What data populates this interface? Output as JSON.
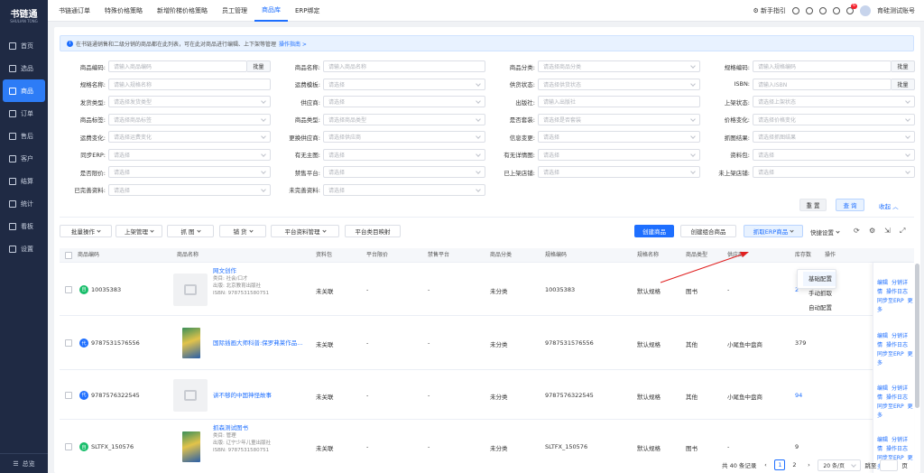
{
  "app": {
    "logo": "书链通",
    "logo_sub": "SHULIAN TONG",
    "footer_label": "总览"
  },
  "sidebar": [
    {
      "label": "首页",
      "active": false
    },
    {
      "label": "选品",
      "active": false
    },
    {
      "label": "商品",
      "active": true
    },
    {
      "label": "订单",
      "active": false
    },
    {
      "label": "售后",
      "active": false
    },
    {
      "label": "客户",
      "active": false
    },
    {
      "label": "结算",
      "active": false
    },
    {
      "label": "统计",
      "active": false
    },
    {
      "label": "看板",
      "active": false
    },
    {
      "label": "设置",
      "active": false
    }
  ],
  "tabs": [
    {
      "label": "书链通订单"
    },
    {
      "label": "特殊价格策略"
    },
    {
      "label": "新增阶梯价格策略"
    },
    {
      "label": "员工管理"
    },
    {
      "label": "商品库",
      "active": true
    },
    {
      "label": "ERP绑定"
    }
  ],
  "topright": {
    "guide": "新手指引",
    "badge": "6",
    "user": "育硅测试账号"
  },
  "notice": {
    "text": "在书链通销售和二级分销的商品都在此列表，可在此对商品进行编辑、上下架等管理",
    "link": "操作指南 >"
  },
  "filters": {
    "batch": "批量",
    "rows": [
      [
        {
          "label": "商品编码:",
          "ph": "请输入商品编码",
          "batch": true
        },
        {
          "label": "商品名称:",
          "ph": "请输入商品名称"
        },
        {
          "label": "商品分类:",
          "ph": "请选择商品分类",
          "sel": true
        },
        {
          "label": "规格编码:",
          "ph": "请输入规格编码",
          "batch": true
        }
      ],
      [
        {
          "label": "规格名称:",
          "ph": "请输入规格名称"
        },
        {
          "label": "运费模板:",
          "ph": "请选择",
          "sel": true
        },
        {
          "label": "供货状态:",
          "ph": "请选择供货状态",
          "sel": true
        },
        {
          "label": "ISBN:",
          "ph": "请输入ISBN",
          "batch": true
        }
      ],
      [
        {
          "label": "发货类型:",
          "ph": "请选择发货类型",
          "sel": true
        },
        {
          "label": "供应商:",
          "ph": "请选择",
          "sel": true
        },
        {
          "label": "出版社:",
          "ph": "请输入出版社"
        },
        {
          "label": "上架状态:",
          "ph": "请选择上架状态",
          "sel": true
        }
      ],
      [
        {
          "label": "商品标签:",
          "ph": "请选择商品标签",
          "sel": true
        },
        {
          "label": "商品类型:",
          "ph": "请选择商品类型",
          "sel": true
        },
        {
          "label": "是否套装:",
          "ph": "请选择是否套装",
          "sel": true
        },
        {
          "label": "价格变化:",
          "ph": "请选择价格变化",
          "sel": true
        }
      ],
      [
        {
          "label": "运费变化:",
          "ph": "请选择运费变化",
          "sel": true
        },
        {
          "label": "更换供应商:",
          "ph": "请选择供应商",
          "sel": true
        },
        {
          "label": "信息变更:",
          "ph": "请选择",
          "sel": true
        },
        {
          "label": "抓图结果:",
          "ph": "请选择抓图结果",
          "sel": true
        }
      ],
      [
        {
          "label": "同步ERP:",
          "ph": "请选择",
          "sel": true
        },
        {
          "label": "有无主图:",
          "ph": "请选择",
          "sel": true
        },
        {
          "label": "有无详情图:",
          "ph": "请选择",
          "sel": true
        },
        {
          "label": "资料包:",
          "ph": "请选择",
          "sel": true
        }
      ],
      [
        {
          "label": "是否限价:",
          "ph": "请选择",
          "sel": true
        },
        {
          "label": "禁售平台:",
          "ph": "请选择",
          "sel": true
        },
        {
          "label": "已上架店铺:",
          "ph": "请选择",
          "sel": true
        },
        {
          "label": "未上架店铺:",
          "ph": "请选择",
          "sel": true
        }
      ],
      [
        {
          "label": "已完善资料:",
          "ph": "请选择",
          "sel": true
        },
        {
          "label": "未完善资料:",
          "ph": "请选择",
          "sel": true
        }
      ]
    ],
    "reset": "重 置",
    "search": "查 询",
    "collapse": "收起"
  },
  "toolbar": {
    "left": [
      "批量操作",
      "上架管理",
      "抓 图",
      "铺 货",
      "平台资料管理"
    ],
    "map": "平台类目映射",
    "create": "创建商品",
    "create_combo": "创建组合商品",
    "fetch_erp": "抓取ERP商品",
    "quick": "快捷设置"
  },
  "dropdown": [
    "基础配置",
    "手动抓取",
    "自动配置"
  ],
  "table": {
    "headers": [
      "商品编码",
      "商品名称",
      "资料包",
      "平台限价",
      "禁售平台",
      "商品分类",
      "规格编码",
      "规格名称",
      "商品类型",
      "供应商",
      "库存数",
      "操作"
    ],
    "rows": [
      {
        "code": "10035383",
        "tag": "自",
        "tagcolor": "#19be6b",
        "name": "网文创作",
        "meta1": "类目: 社会/口才",
        "meta2": "出版: 北京教育出版社",
        "meta3": "ISBN: 9787531580751",
        "pkg": "未关联",
        "limit": "-",
        "ban": "-",
        "cat": "未分类",
        "sku": "10035383",
        "spec": "默认规格",
        "type": "图书",
        "sup": "-",
        "stock": "2",
        "img": "ph"
      },
      {
        "code": "9787531576556",
        "tag": "代",
        "tagcolor": "#1e6fff",
        "name": "国际插画大师科普:保罗弗莱作品...",
        "meta1": "",
        "meta2": "",
        "meta3": "",
        "pkg": "未关联",
        "limit": "-",
        "ban": "-",
        "cat": "未分类",
        "sku": "9787531576556",
        "spec": "默认规格",
        "type": "其他",
        "sup": "小尾鱼中盘商",
        "stock": "379",
        "img": "book"
      },
      {
        "code": "9787576322545",
        "tag": "代",
        "tagcolor": "#1e6fff",
        "name": "讲不够的中国神怪故事",
        "meta1": "",
        "meta2": "",
        "meta3": "",
        "pkg": "未关联",
        "limit": "-",
        "ban": "-",
        "cat": "未分类",
        "sku": "9787576322545",
        "spec": "默认规格",
        "type": "其他",
        "sup": "小尾鱼中盘商",
        "stock": "94",
        "img": "ph"
      },
      {
        "code": "SLTFX_150576",
        "tag": "自",
        "tagcolor": "#19be6b",
        "name": "抓森测试图书",
        "meta1": "类目: 管理",
        "meta2": "出版: 辽宁少年儿童出版社",
        "meta3": "ISBN: 9787531580751",
        "pkg": "未关联",
        "limit": "-",
        "ban": "-",
        "cat": "未分类",
        "sku": "SLTFX_150576",
        "spec": "默认规格",
        "type": "图书",
        "sup": "-",
        "stock": "9",
        "img": "book"
      }
    ],
    "ops": {
      "edit": "编辑",
      "dist": "分销详情",
      "log": "操作日志",
      "sync": "同步至ERP",
      "more": "更多"
    }
  },
  "pager": {
    "total": "共 40 条记录",
    "pages": [
      "1",
      "2"
    ],
    "size": "20 条/页",
    "jump": "跳至",
    "unit": "页"
  }
}
